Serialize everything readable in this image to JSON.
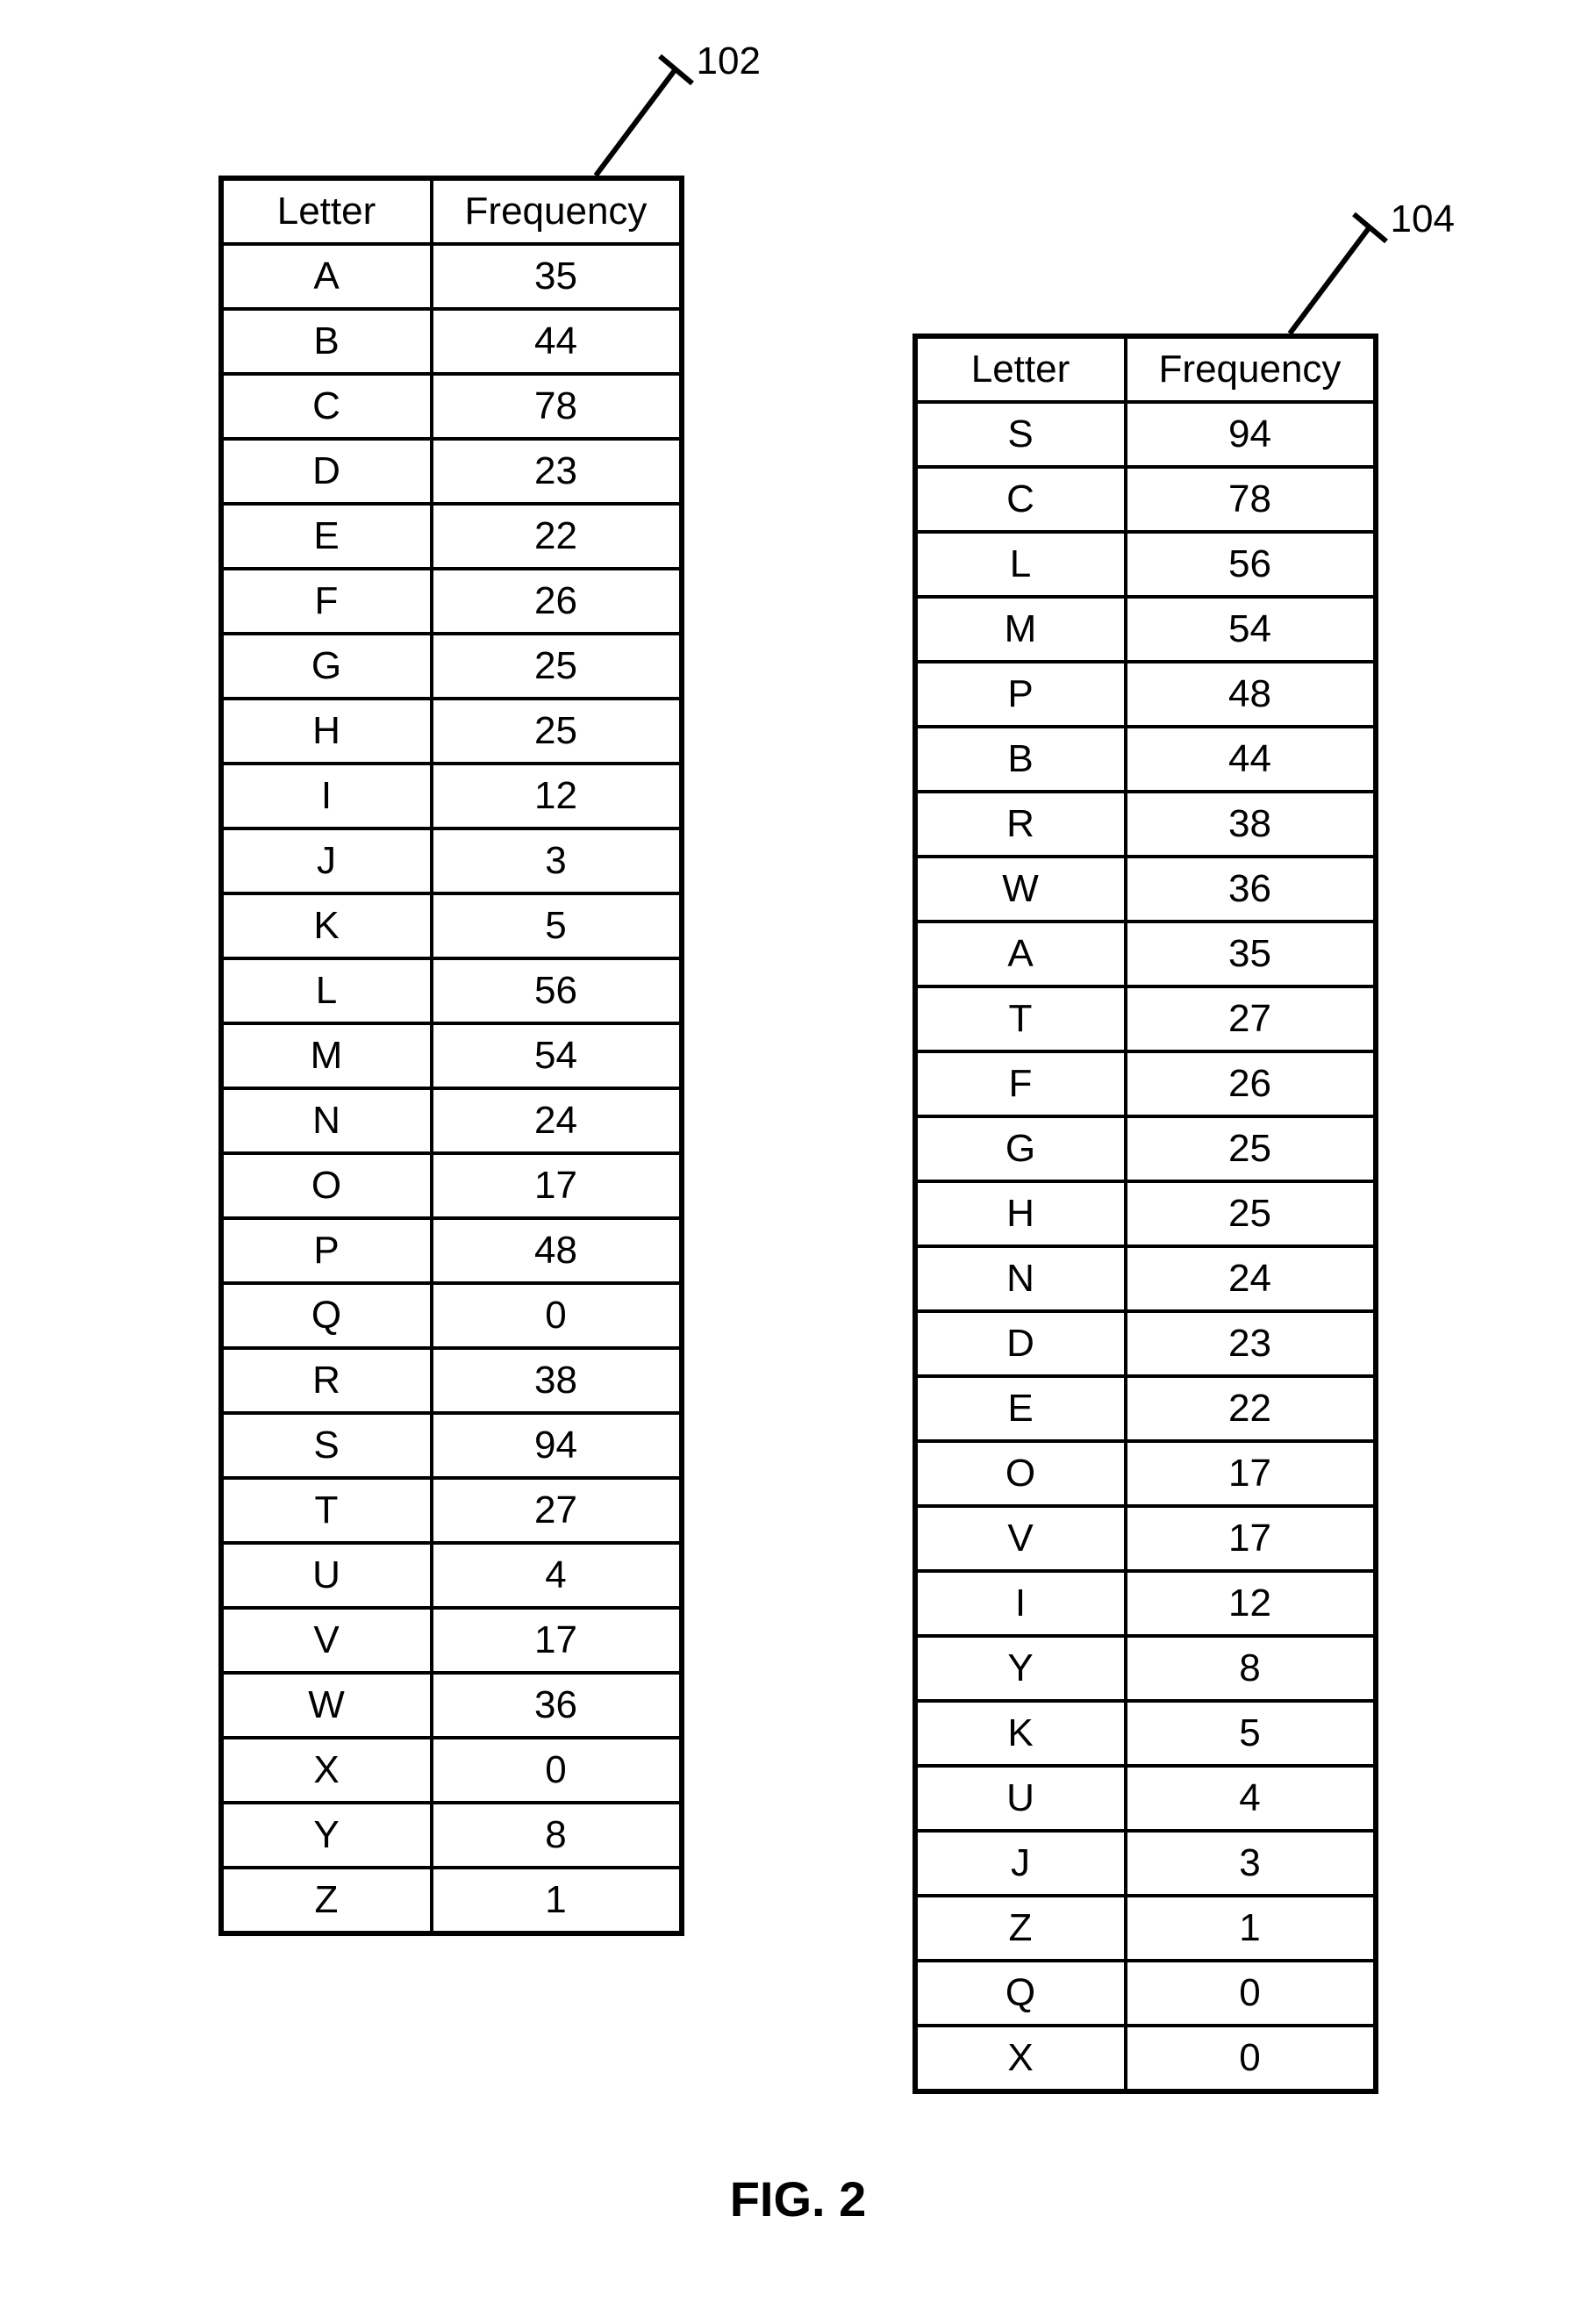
{
  "table_left": {
    "ref": "102",
    "headers": {
      "letter": "Letter",
      "frequency": "Frequency"
    },
    "rows": [
      {
        "letter": "A",
        "frequency": 35
      },
      {
        "letter": "B",
        "frequency": 44
      },
      {
        "letter": "C",
        "frequency": 78
      },
      {
        "letter": "D",
        "frequency": 23
      },
      {
        "letter": "E",
        "frequency": 22
      },
      {
        "letter": "F",
        "frequency": 26
      },
      {
        "letter": "G",
        "frequency": 25
      },
      {
        "letter": "H",
        "frequency": 25
      },
      {
        "letter": "I",
        "frequency": 12
      },
      {
        "letter": "J",
        "frequency": 3
      },
      {
        "letter": "K",
        "frequency": 5
      },
      {
        "letter": "L",
        "frequency": 56
      },
      {
        "letter": "M",
        "frequency": 54
      },
      {
        "letter": "N",
        "frequency": 24
      },
      {
        "letter": "O",
        "frequency": 17
      },
      {
        "letter": "P",
        "frequency": 48
      },
      {
        "letter": "Q",
        "frequency": 0
      },
      {
        "letter": "R",
        "frequency": 38
      },
      {
        "letter": "S",
        "frequency": 94
      },
      {
        "letter": "T",
        "frequency": 27
      },
      {
        "letter": "U",
        "frequency": 4
      },
      {
        "letter": "V",
        "frequency": 17
      },
      {
        "letter": "W",
        "frequency": 36
      },
      {
        "letter": "X",
        "frequency": 0
      },
      {
        "letter": "Y",
        "frequency": 8
      },
      {
        "letter": "Z",
        "frequency": 1
      }
    ]
  },
  "table_right": {
    "ref": "104",
    "headers": {
      "letter": "Letter",
      "frequency": "Frequency"
    },
    "rows": [
      {
        "letter": "S",
        "frequency": 94
      },
      {
        "letter": "C",
        "frequency": 78
      },
      {
        "letter": "L",
        "frequency": 56
      },
      {
        "letter": "M",
        "frequency": 54
      },
      {
        "letter": "P",
        "frequency": 48
      },
      {
        "letter": "B",
        "frequency": 44
      },
      {
        "letter": "R",
        "frequency": 38
      },
      {
        "letter": "W",
        "frequency": 36
      },
      {
        "letter": "A",
        "frequency": 35
      },
      {
        "letter": "T",
        "frequency": 27
      },
      {
        "letter": "F",
        "frequency": 26
      },
      {
        "letter": "G",
        "frequency": 25
      },
      {
        "letter": "H",
        "frequency": 25
      },
      {
        "letter": "N",
        "frequency": 24
      },
      {
        "letter": "D",
        "frequency": 23
      },
      {
        "letter": "E",
        "frequency": 22
      },
      {
        "letter": "O",
        "frequency": 17
      },
      {
        "letter": "V",
        "frequency": 17
      },
      {
        "letter": "I",
        "frequency": 12
      },
      {
        "letter": "Y",
        "frequency": 8
      },
      {
        "letter": "K",
        "frequency": 5
      },
      {
        "letter": "U",
        "frequency": 4
      },
      {
        "letter": "J",
        "frequency": 3
      },
      {
        "letter": "Z",
        "frequency": 1
      },
      {
        "letter": "Q",
        "frequency": 0
      },
      {
        "letter": "X",
        "frequency": 0
      }
    ]
  },
  "caption": "FIG. 2"
}
